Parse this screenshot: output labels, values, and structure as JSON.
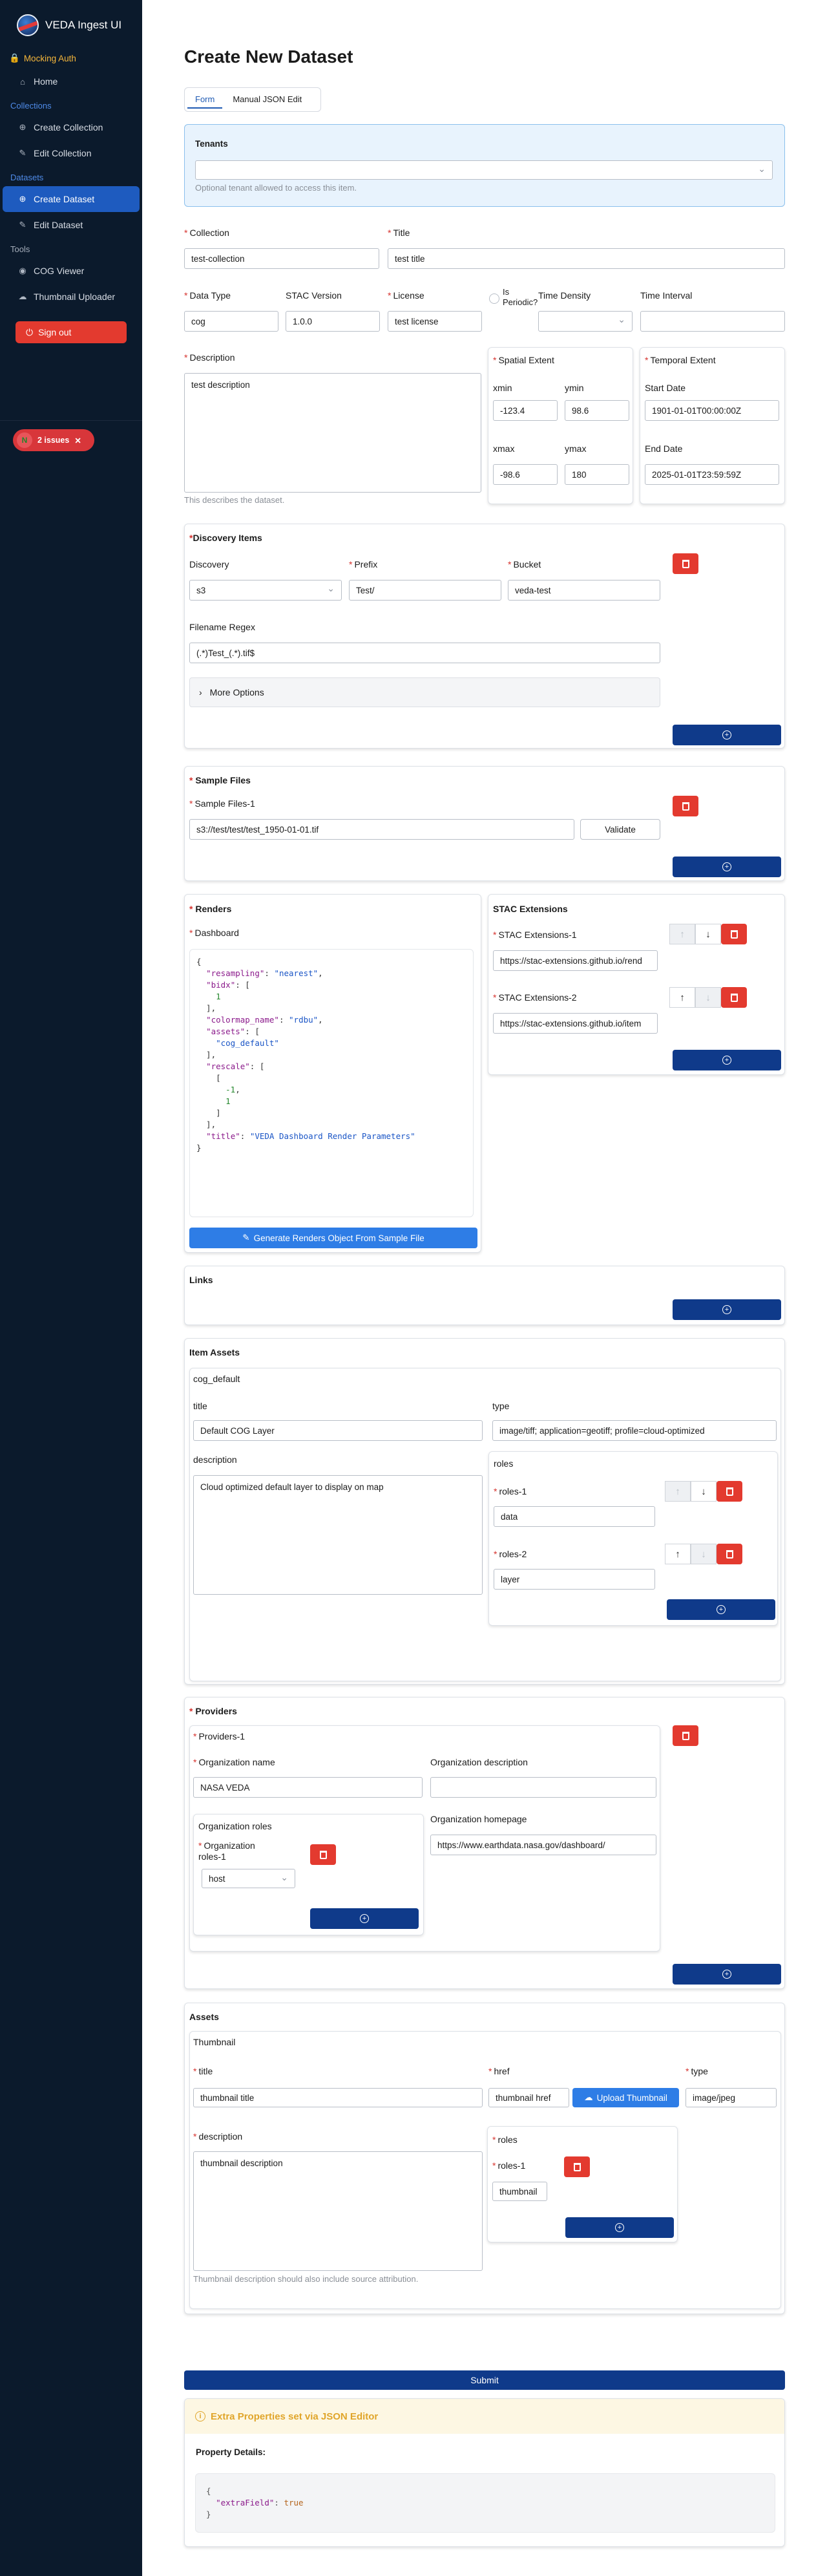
{
  "app": {
    "title": "VEDA Ingest UI",
    "auth_label": "Mocking Auth"
  },
  "sidebar": {
    "sections": [
      {
        "label": "Collections"
      },
      {
        "label": "Datasets"
      },
      {
        "label": "Tools"
      }
    ],
    "items": [
      {
        "label": "Home",
        "icon": "home-icon"
      },
      {
        "label": "Create Collection",
        "icon": "plus-circle-icon"
      },
      {
        "label": "Edit Collection",
        "icon": "pencil-icon"
      },
      {
        "label": "Create Dataset",
        "icon": "plus-circle-icon"
      },
      {
        "label": "Edit Dataset",
        "icon": "pencil-icon"
      },
      {
        "label": "COG Viewer",
        "icon": "eye-icon"
      },
      {
        "label": "Thumbnail Uploader",
        "icon": "upload-icon"
      }
    ],
    "signout_label": "Sign out",
    "issues": {
      "avatar": "N",
      "label": "2 issues"
    }
  },
  "page": {
    "title": "Create New Dataset",
    "tabs": [
      "Form",
      "Manual JSON Edit"
    ],
    "active_tab": "Form"
  },
  "tenants": {
    "label": "Tenants",
    "value": "",
    "hint": "Optional tenant allowed to access this item."
  },
  "fields": {
    "collection": {
      "label": "Collection",
      "value": "test-collection"
    },
    "title": {
      "label": "Title",
      "value": "test title"
    },
    "data_type": {
      "label": "Data Type",
      "value": "cog"
    },
    "stac_version": {
      "label": "STAC Version",
      "value": "1.0.0"
    },
    "license": {
      "label": "License",
      "value": "test license"
    },
    "is_periodic": {
      "label": "Is Periodic?"
    },
    "time_density": {
      "label": "Time Density",
      "value": ""
    },
    "time_interval": {
      "label": "Time Interval",
      "value": ""
    },
    "description": {
      "label": "Description",
      "value": "test description",
      "hint": "This describes the dataset."
    }
  },
  "spatial_extent": {
    "label": "Spatial Extent",
    "xmin": {
      "label": "xmin",
      "value": "-123.4"
    },
    "ymin": {
      "label": "ymin",
      "value": "98.6"
    },
    "xmax": {
      "label": "xmax",
      "value": "-98.6"
    },
    "ymax": {
      "label": "ymax",
      "value": "180"
    }
  },
  "temporal_extent": {
    "label": "Temporal Extent",
    "start": {
      "label": "Start Date",
      "value": "1901-01-01T00:00:00Z"
    },
    "end": {
      "label": "End Date",
      "value": "2025-01-01T23:59:59Z"
    }
  },
  "discovery_items": {
    "label": "Discovery Items",
    "discovery": {
      "label": "Discovery",
      "value": "s3"
    },
    "prefix": {
      "label": "Prefix",
      "value": "Test/"
    },
    "bucket": {
      "label": "Bucket",
      "value": "veda-test"
    },
    "filename_regex": {
      "label": "Filename Regex",
      "value": "(.*)Test_(.*).tif$"
    },
    "more_options": "More Options"
  },
  "sample_files": {
    "label": "Sample Files",
    "item_label": "Sample Files-1",
    "value": "s3://test/test/test_1950-01-01.tif",
    "validate_label": "Validate"
  },
  "renders": {
    "label": "Renders",
    "dashboard_label": "Dashboard",
    "json_lines": [
      "{",
      "  \"resampling\": \"nearest\",",
      "  \"bidx\": [",
      "    1",
      "  ],",
      "  \"colormap_name\": \"rdbu\",",
      "  \"assets\": [",
      "    \"cog_default\"",
      "  ],",
      "  \"rescale\": [",
      "    [",
      "      -1,",
      "      1",
      "    ]",
      "  ],",
      "  \"title\": \"VEDA Dashboard Render Parameters\"",
      "}"
    ],
    "generate_label": "Generate Renders Object From Sample File"
  },
  "stac_extensions": {
    "label": "STAC Extensions",
    "items": [
      {
        "label": "STAC Extensions-1",
        "value": "https://stac-extensions.github.io/rend"
      },
      {
        "label": "STAC Extensions-2",
        "value": "https://stac-extensions.github.io/item"
      }
    ]
  },
  "links": {
    "label": "Links"
  },
  "item_assets": {
    "label": "Item Assets",
    "key": "cog_default",
    "title": {
      "label": "title",
      "value": "Default COG Layer"
    },
    "type": {
      "label": "type",
      "value": "image/tiff; application=geotiff; profile=cloud-optimized"
    },
    "description": {
      "label": "description",
      "value": "Cloud optimized default layer to display on map"
    },
    "roles": {
      "label": "roles",
      "items": [
        {
          "label": "roles-1",
          "value": "data"
        },
        {
          "label": "roles-2",
          "value": "layer"
        }
      ]
    }
  },
  "providers": {
    "label": "Providers",
    "item_label": "Providers-1",
    "org_name": {
      "label": "Organization name",
      "value": "NASA VEDA"
    },
    "org_desc": {
      "label": "Organization description",
      "value": ""
    },
    "org_roles": {
      "label": "Organization roles",
      "item_label": "Organization roles-1",
      "value": "host"
    },
    "org_home": {
      "label": "Organization homepage",
      "value": "https://www.earthdata.nasa.gov/dashboard/"
    }
  },
  "assets": {
    "label": "Assets",
    "key": "Thumbnail",
    "title": {
      "label": "title",
      "value": "thumbnail title"
    },
    "href": {
      "label": "href",
      "value": "thumbnail href"
    },
    "upload_label": "Upload Thumbnail",
    "type": {
      "label": "type",
      "value": "image/jpeg"
    },
    "description": {
      "label": "description",
      "value": "thumbnail description",
      "hint": "Thumbnail description should also include source attribution."
    },
    "roles": {
      "label": "roles",
      "item_label": "roles-1",
      "value": "thumbnail"
    }
  },
  "submit_label": "Submit",
  "extra_props": {
    "heading": "Extra Properties set via JSON Editor",
    "details_label": "Property Details:",
    "json_lines": [
      "{",
      "  \"extraField\": true",
      "}"
    ]
  },
  "colors": {
    "sidebar_bg": "#0b1a2c",
    "primary": "#0f3a8a",
    "accent": "#1e5bbf",
    "danger": "#e33a2f",
    "warning": "#f5b63b"
  }
}
